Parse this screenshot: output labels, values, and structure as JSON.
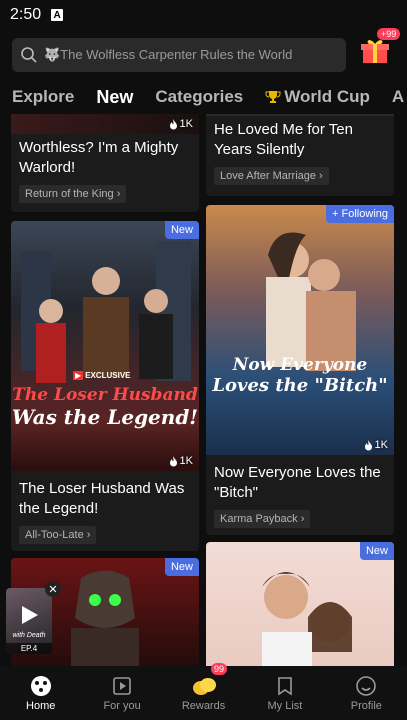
{
  "status": {
    "time": "2:50",
    "indicator": "A"
  },
  "search": {
    "placeholder": "🐺The Wolfless Carpenter Rules the World"
  },
  "gift": {
    "badge": "+99"
  },
  "tabs": [
    {
      "label": "Explore"
    },
    {
      "label": "New"
    },
    {
      "label": "Categories"
    },
    {
      "label": "World Cup"
    },
    {
      "label": "A"
    }
  ],
  "cards": {
    "c1": {
      "title": "Worthless? I'm a Mighty Warlord!",
      "tag": "Return of the King",
      "views": "1K"
    },
    "c2": {
      "title": "He Loved Me for Ten Years Silently",
      "tag": "Love After Marriage"
    },
    "c3": {
      "title": "The Loser Husband Was the Legend!",
      "tag": "All-Too-Late",
      "views": "1K",
      "badge": "New",
      "cover_brand": "EXCLUSIVE",
      "cover_title_1": "The Loser Husband",
      "cover_title_2": "Was the Legend!"
    },
    "c4": {
      "title": "Now Everyone Loves the \"Bitch\"",
      "tag": "Karma Payback",
      "views": "1K",
      "badge": "Following",
      "cover_title_1": "Now Everyone",
      "cover_title_2": "Loves the \"Bitch\""
    },
    "c5": {
      "badge": "New"
    },
    "c6": {
      "badge": "New"
    }
  },
  "mini_player": {
    "episode": "EP.4",
    "cover_text": "with Death"
  },
  "nav": [
    {
      "label": "Home"
    },
    {
      "label": "For you"
    },
    {
      "label": "Rewards",
      "badge": "99"
    },
    {
      "label": "My List"
    },
    {
      "label": "Profile"
    }
  ],
  "colors": {
    "accent": "#4a6ee0",
    "badge_red": "#ff3d5a",
    "background": "#0e0e0e"
  }
}
